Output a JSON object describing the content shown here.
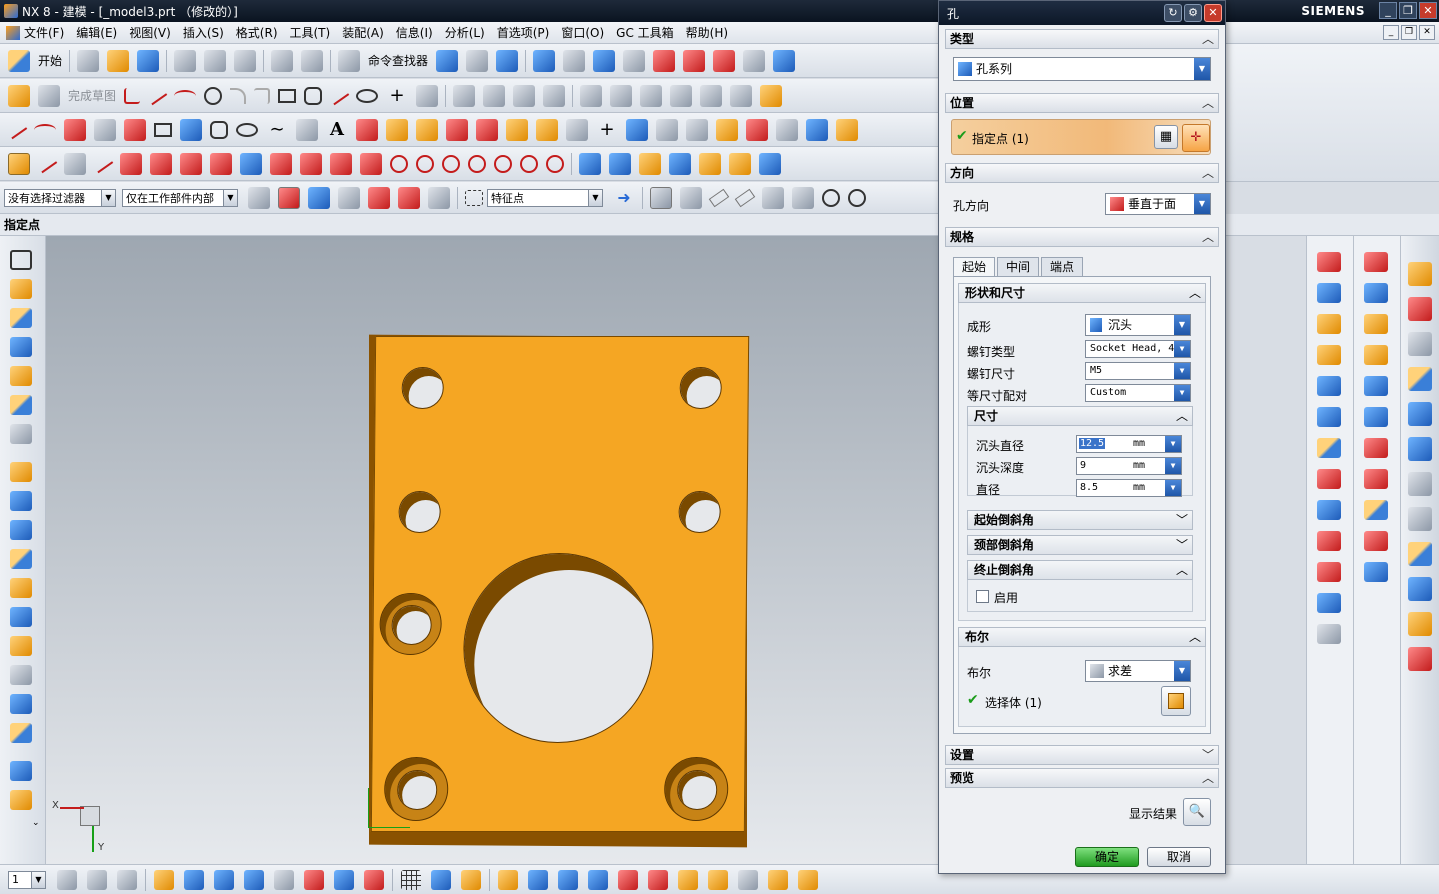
{
  "window": {
    "title": "NX 8 - 建模 - [_model3.prt （修改的）]",
    "brand": "SIEMENS",
    "controls": [
      "_",
      "❐",
      "✕"
    ]
  },
  "menu": [
    "文件(F)",
    "编辑(E)",
    "视图(V)",
    "插入(S)",
    "格式(R)",
    "工具(T)",
    "装配(A)",
    "信息(I)",
    "分析(L)",
    "首选项(P)",
    "窗口(O)",
    "GC 工具箱",
    "帮助(H)"
  ],
  "toolbar": {
    "start_label": "开始",
    "command_finder_label": "命令查找器",
    "finish_sketch_label": "完成草图"
  },
  "selection": {
    "filter": "没有选择过滤器",
    "scope": "仅在工作部件内部",
    "snap": "特征点"
  },
  "cue_line": "指定点",
  "viewport": {
    "axis_x": "X",
    "axis_y": "Y",
    "plate_color": "#f5a623"
  },
  "bottom": {
    "layer_value": "1"
  },
  "dialog": {
    "title": "孔",
    "type": {
      "header": "类型",
      "value": "孔系列"
    },
    "position": {
      "header": "位置",
      "specify_point": "指定点 (1)"
    },
    "direction": {
      "header": "方向",
      "label": "孔方向",
      "value": "垂直于面"
    },
    "spec": {
      "header": "规格",
      "tabs": [
        "起始",
        "中间",
        "端点"
      ],
      "shape": {
        "header": "形状和尺寸",
        "form_label": "成形",
        "form_value": "沉头",
        "screw_type_label": "螺钉类型",
        "screw_type_value": "Socket Head, 4",
        "screw_size_label": "螺钉尺寸",
        "screw_size_value": "M5",
        "fit_label": "等尺寸配对",
        "fit_value": "Custom"
      },
      "dimensions": {
        "header": "尺寸",
        "cb_diameter_label": "沉头直径",
        "cb_diameter_value": "12.5",
        "cb_depth_label": "沉头深度",
        "cb_depth_value": "9",
        "diameter_label": "直径",
        "diameter_value": "8.5",
        "unit": "mm"
      },
      "start_chamfer": "起始倒斜角",
      "neck_chamfer": "颈部倒斜角",
      "end_chamfer": {
        "header": "终止倒斜角",
        "enable_label": "启用"
      }
    },
    "boolean": {
      "header": "布尔",
      "label": "布尔",
      "value": "求差",
      "select_body": "选择体 (1)"
    },
    "settings": {
      "header": "设置"
    },
    "preview": {
      "header": "预览",
      "show_result": "显示结果"
    },
    "ok_label": "确定",
    "cancel_label": "取消"
  }
}
